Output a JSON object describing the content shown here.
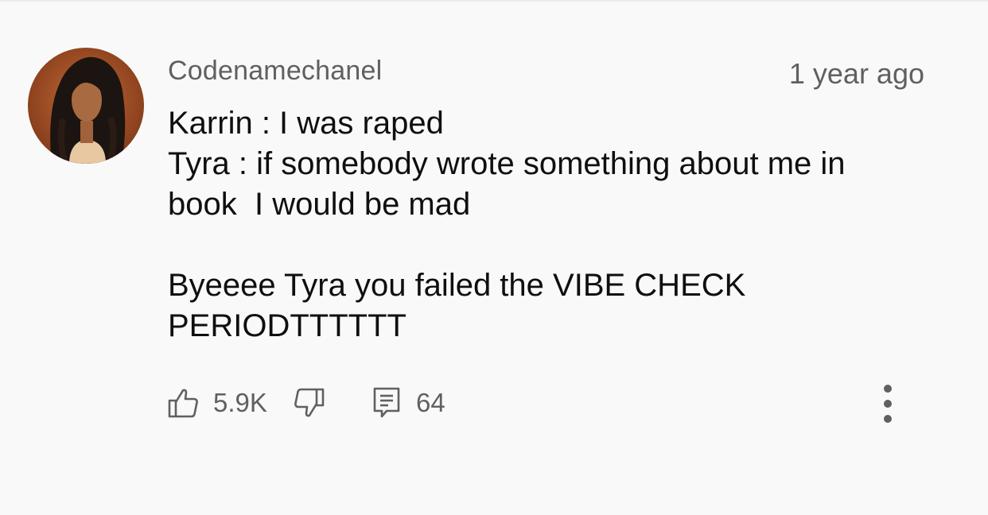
{
  "comment": {
    "author": "Codenamechanel",
    "timestamp": "1 year ago",
    "lines": [
      "Karrin : I was raped",
      "Tyra : if somebody wrote something about me in",
      "book  I would be mad",
      "",
      "Byeeee Tyra you failed the VIBE CHECK",
      "PERIODTTTTTT"
    ]
  },
  "actions": {
    "like_count": "5.9K",
    "reply_count": "64"
  },
  "icons": {
    "like": "thumbs-up-icon",
    "dislike": "thumbs-down-icon",
    "reply": "comment-icon",
    "more": "more-vertical-icon"
  },
  "colors": {
    "background": "#f9f9f9",
    "text_primary": "#0f0f0f",
    "text_secondary": "#606060"
  }
}
